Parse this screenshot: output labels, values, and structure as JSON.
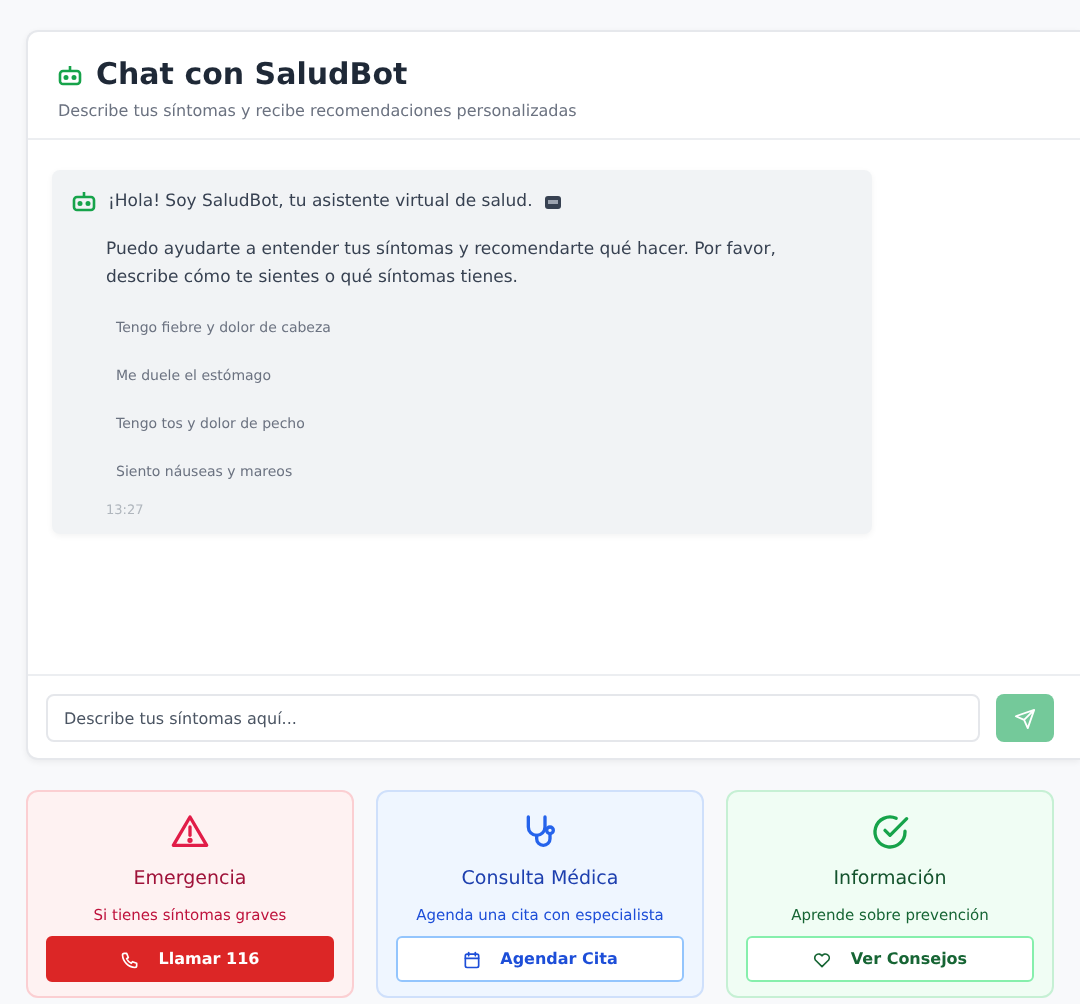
{
  "chat": {
    "title": "Chat con SaludBot",
    "subtitle": "Describe tus síntomas y recibe recomendaciones personalizadas",
    "message": {
      "greeting": "¡Hola! Soy SaludBot, tu asistente virtual de salud.",
      "body": "Puedo ayudarte a entender tus síntomas y recomendarte qué hacer. Por favor, describe cómo te sientes o qué síntomas tienes.",
      "suggestions": [
        "Tengo fiebre y dolor de cabeza",
        "Me duele el estómago",
        "Tengo tos y dolor de pecho",
        "Siento náuseas y mareos"
      ],
      "time": "13:27"
    },
    "input": {
      "placeholder": "Describe tus síntomas aquí..."
    }
  },
  "cards": [
    {
      "kind": "emergency",
      "title": "Emergencia",
      "subtitle": "Si tienes síntomas graves",
      "button": "Llamar 116"
    },
    {
      "kind": "appointment",
      "title": "Consulta Médica",
      "subtitle": "Agenda una cita con especialista",
      "button": "Agendar Cita"
    },
    {
      "kind": "info",
      "title": "Información",
      "subtitle": "Aprende sobre prevención",
      "button": "Ver Consejos"
    }
  ]
}
